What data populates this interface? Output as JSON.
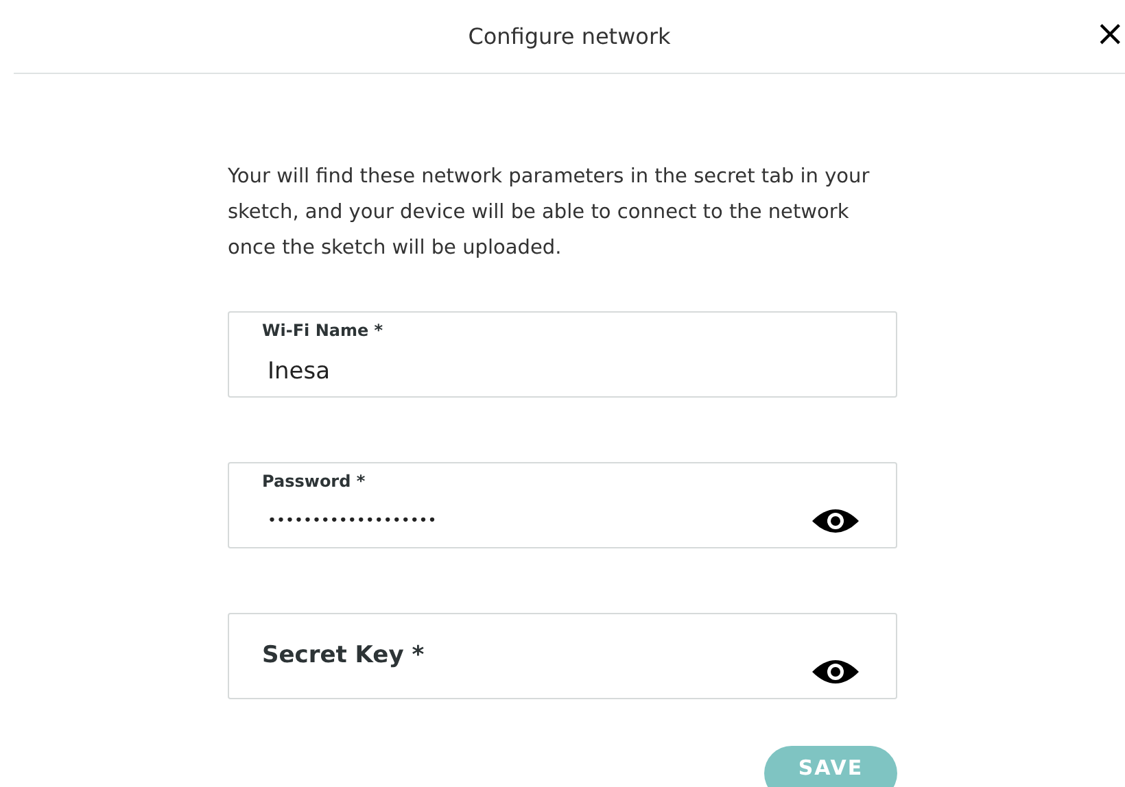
{
  "dialog": {
    "title": "Configure network",
    "close": "×"
  },
  "description": "Your will find these network parameters in the secret tab in your sketch, and your device will be able to connect to the network once the sketch will be uploaded.",
  "fields": [
    {
      "kind": "text",
      "label": "Wi-Fi Name *",
      "value": "Inesa"
    },
    {
      "kind": "password",
      "label": "Password *",
      "value": "•••••••••••••••••••"
    },
    {
      "kind": "password",
      "label": "Secret Key *"
    }
  ],
  "save_button": {
    "label": "SAVE",
    "disabled": true
  }
}
